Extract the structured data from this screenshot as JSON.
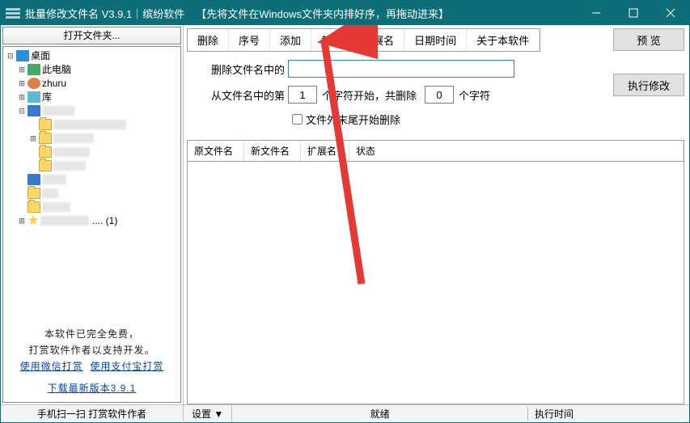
{
  "title": "批量修改文件名  V3.9.1｜缤纷软件",
  "title_hint": "【先将文件在Windows文件夹内排好序，再拖动进来】",
  "sidebar": {
    "header": "打开文件夹...",
    "tree": {
      "desktop": "桌面",
      "thispc": "此电脑",
      "user": "zhuru",
      "lib": "库",
      "blur1": "　",
      "blur2": "　",
      "blur3": "　",
      "blur4": "　",
      "blur5": "　",
      "last_suffix": ".... (1)"
    },
    "free": {
      "line1": "本软件已完全免费，",
      "line2": "打赏软件作者以支持开发。",
      "wx": "使用微信打赏",
      "zfb": "使用支付宝打赏",
      "download": "下载最新版本3.9.1"
    }
  },
  "tabs": [
    "删除",
    "序号",
    "添加",
    "替换",
    "扩展名",
    "日期时间",
    "关于本软件"
  ],
  "buttons": {
    "preview": "预    览",
    "execute": "执行修改"
  },
  "panel": {
    "deleteLabel": "删除文件名中的",
    "deleteValue": "",
    "fromA": "从文件名中的第",
    "startValue": "1",
    "fromB": "个字符开始，共删除",
    "countValue": "0",
    "fromC": "个字符",
    "tailChk": "文件外末尾开始删除"
  },
  "columns": [
    "原文件名",
    "新文件名",
    "扩展名",
    "状态"
  ],
  "status": {
    "left": "手机扫一扫  打赏软件作者",
    "set": "设置 ▼",
    "ready": "就绪",
    "time": "执行时间"
  }
}
